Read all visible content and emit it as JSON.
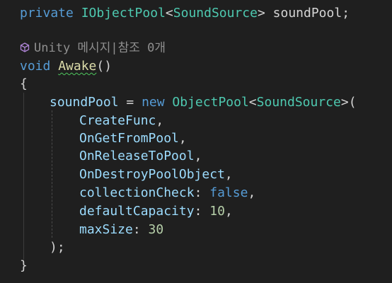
{
  "code": {
    "line_pool": {
      "kw_private": "private",
      "type_iobjectpool": "IObjectPool",
      "lt": "<",
      "type_soundsource": "SoundSource",
      "gt_name": "> soundPool;"
    },
    "codelens": {
      "text": "Unity 메시지|참조 0개"
    },
    "line_awake": {
      "kw_void": "void",
      "method": "Awake",
      "parens": "()"
    },
    "brace_open": "{",
    "line_new": {
      "target": "soundPool",
      "assign": " = ",
      "kw_new": "new",
      "type_objectpool": "ObjectPool",
      "lt": "<",
      "type_soundsource": "SoundSource",
      "gt_paren": ">("
    },
    "args": [
      {
        "name": "CreateFunc",
        "sep": ","
      },
      {
        "name": "OnGetFromPool",
        "sep": ","
      },
      {
        "name": "OnReleaseToPool",
        "sep": ","
      },
      {
        "name": "OnDestroyPoolObject",
        "sep": ","
      }
    ],
    "named_args": [
      {
        "name": "collectionCheck",
        "colon": ": ",
        "value": "false",
        "sep": ","
      },
      {
        "name": "defaultCapacity",
        "colon": ": ",
        "value": "10",
        "sep": ","
      },
      {
        "name": "maxSize",
        "colon": ": ",
        "value": "30",
        "sep": ""
      }
    ],
    "close_call": ");",
    "brace_close": "}"
  },
  "colors": {
    "background": "#1f1f1f",
    "keyword": "#569cd6",
    "type": "#4ec9b0",
    "method": "#dcdcaa",
    "variable": "#9cdcfe",
    "number": "#b5cea8",
    "text": "#d4d4d4",
    "codelens": "#8f8f8f"
  },
  "icons": {
    "codelens_icon": "unity-cube-icon"
  }
}
